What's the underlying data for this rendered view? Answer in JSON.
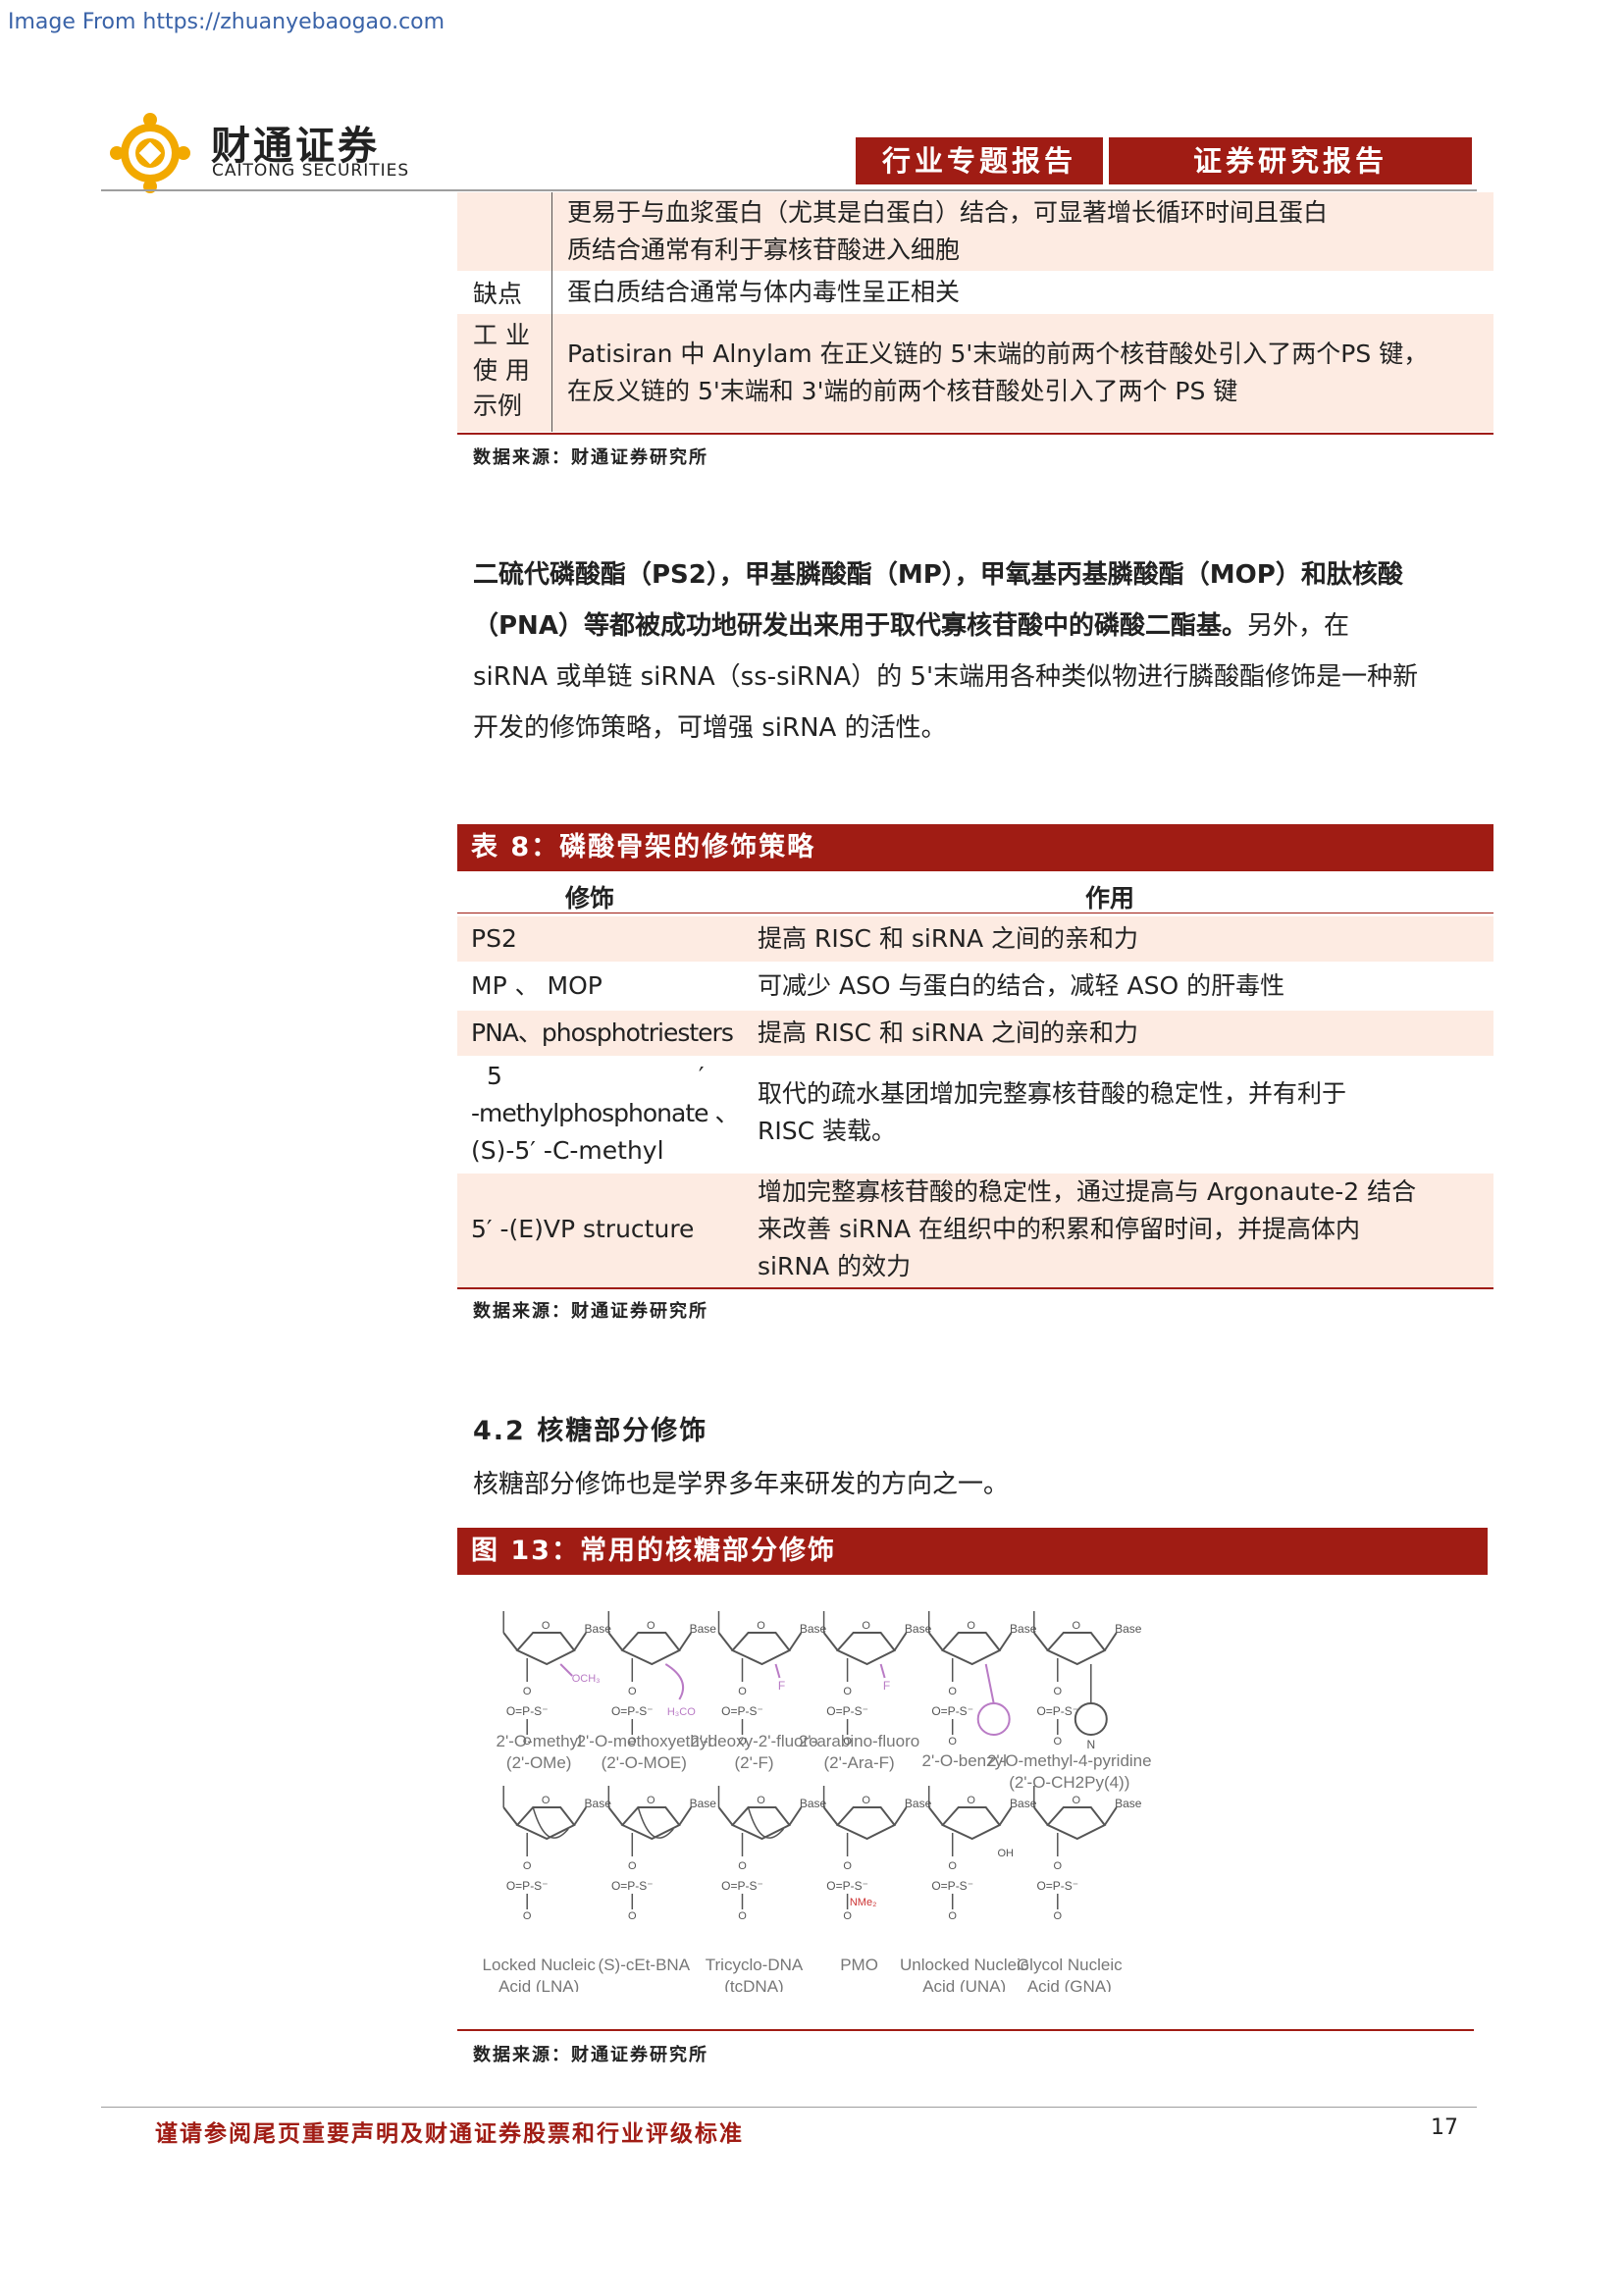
{
  "watermark": "Image From https://zhuanyebaogao.com",
  "header": {
    "brand_cn": "财通证券",
    "brand_en": "CAITONG SECURITIES",
    "tag1": "行业专题报告",
    "tag2": "证券研究报告"
  },
  "table_top": {
    "rows": [
      {
        "label": "",
        "text_line1": "更易于与血浆蛋白（尤其是白蛋白）结合，可显著增长循环时间且蛋白",
        "text_line2": "质结合通常有利于寡核苷酸进入细胞"
      },
      {
        "label": "缺点",
        "text": "蛋白质结合通常与体内毒性呈正相关"
      },
      {
        "label_line1": "工 业",
        "label_line2": "使 用",
        "label_line3": "示例",
        "text_line1": "Patisiran 中 Alnylam 在正义链的 5'末端的前两个核苷酸处引入了两个PS 键，",
        "text_line2": "在反义链的 5'末端和 3'端的前两个核苷酸处引入了两个 PS 键"
      }
    ],
    "source": "数据来源：财通证券研究所"
  },
  "paragraph": {
    "bold": "二硫代磷酸酯（PS2），甲基膦酸酯（MP），甲氧基丙基膦酸酯（MOP）和肽核酸（PNA）等都被成功地研发出来用于取代寡核苷酸中的磷酸二酯基。",
    "line1": "二硫代磷酸酯（PS2），甲基膦酸酯（MP），甲氧基丙基膦酸酯（MOP）和肽核酸",
    "line2_bold": "（PNA）等都被成功地研发出来用于取代寡核苷酸中的磷酸二酯基。",
    "line2_rest": "另外，在",
    "line3": "siRNA 或单链 siRNA（ss-siRNA）的 5'末端用各种类似物进行膦酸酯修饰是一种新",
    "line4": "开发的修饰策略，可增强 siRNA 的活性。"
  },
  "table8": {
    "title": "表 8：磷酸骨架的修饰策略",
    "col1": "修饰",
    "col2": "作用",
    "rows": [
      {
        "a": "PS2",
        "b": "提高 RISC 和 siRNA 之间的亲和力"
      },
      {
        "a": "MP 、 MOP",
        "b": "可减少 ASO 与蛋白的结合，减轻 ASO 的肝毒性"
      },
      {
        "a": "PNA、phosphotriesters",
        "b": "提高 RISC 和 siRNA 之间的亲和力"
      },
      {
        "a1": "5",
        "a1b": "′",
        "a2": "-methylphosphonate 、",
        "a3": "(S)-5′ -C-methyl",
        "b1": "取代的疏水基团增加完整寡核苷酸的稳定性，并有利于",
        "b2": "RISC 装载。"
      },
      {
        "a": "5′ -(E)VP structure",
        "b1": "增加完整寡核苷酸的稳定性，通过提高与 Argonaute-2 结合",
        "b2": "来改善 siRNA 在组织中的积累和停留时间，并提高体内",
        "b3": "siRNA 的效力"
      }
    ],
    "source": "数据来源：财通证券研究所"
  },
  "section": {
    "heading": "4.2  核糖部分修饰",
    "text": "核糖部分修饰也是学界多年来研发的方向之一。"
  },
  "figure13": {
    "title": "图 13：常用的核糖部分修饰",
    "row1": [
      {
        "l1": "2'-O-methyl",
        "l2": "(2'-OMe)",
        "sub": "OCH₃"
      },
      {
        "l1": "2'-O-methoxyethyl",
        "l2": "(2'-O-MOE)",
        "sub": "H₃CO"
      },
      {
        "l1": "2'-deoxy-2'-fluoro",
        "l2": "(2'-F)",
        "sub": "F"
      },
      {
        "l1": "2'-arabino-fluoro",
        "l2": "(2'-Ara-F)",
        "sub": "F"
      },
      {
        "l1": "2'-O-benzyl",
        "l2": "",
        "sub": ""
      },
      {
        "l1": "2'-O-methyl-4-pyridine",
        "l2": "(2'-O-CH2Py(4))",
        "sub": "N"
      }
    ],
    "row2": [
      {
        "l1": "Locked Nucleic",
        "l2": "Acid (LNA)"
      },
      {
        "l1": "(S)-cEt-BNA",
        "l2": ""
      },
      {
        "l1": "Tricyclo-DNA",
        "l2": "(tcDNA)"
      },
      {
        "l1": "PMO",
        "l2": "",
        "sub": "NMe₂"
      },
      {
        "l1": "Unlocked Nucleic",
        "l2": "Acid (UNA)",
        "sub": "OH"
      },
      {
        "l1": "Glycol Nucleic",
        "l2": "Acid (GNA)"
      }
    ],
    "base_label": "Base",
    "p_label": "O=P-S⁻",
    "o_label": "O",
    "source": "数据来源：财通证券研究所"
  },
  "footer": {
    "note": "谨请参阅尾页重要声明及财通证券股票和行业评级标准",
    "page": "17"
  }
}
